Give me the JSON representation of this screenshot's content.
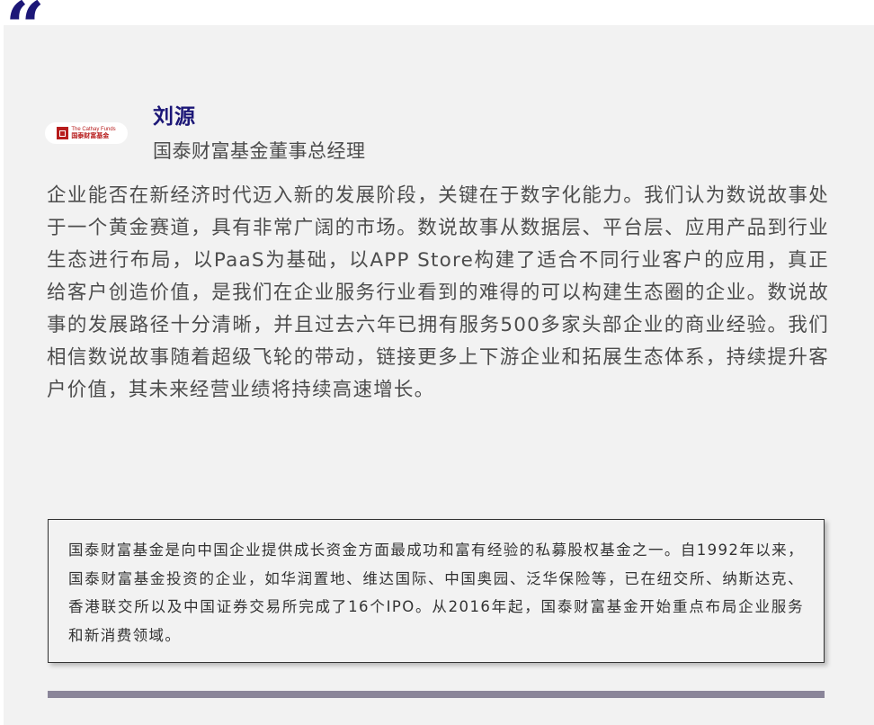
{
  "quote": {
    "mark": "“"
  },
  "logo": {
    "english": "The Cathay Funds",
    "chinese": "国泰财富基金"
  },
  "profile": {
    "name": "刘源",
    "title": "国泰财富基金董事总经理"
  },
  "quote_body": "企业能否在新经济时代迈入新的发展阶段，关键在于数字化能力。我们认为数说故事处于一个黄金赛道，具有非常广阔的市场。数说故事从数据层、平台层、应用产品到行业生态进行布局，以PaaS为基础，以APP Store构建了适合不同行业客户的应用，真正给客户创造价值，是我们在企业服务行业看到的难得的可以构建生态圈的企业。数说故事的发展路径十分清晰，并且过去六年已拥有服务500多家头部企业的商业经验。我们相信数说故事随着超级飞轮的带动，链接更多上下游企业和拓展生态体系，持续提升客户价值，其未来经营业绩将持续高速增长。",
  "about": "国泰财富基金是向中国企业提供成长资金方面最成功和富有经验的私募股权基金之一。自1992年以来，国泰财富基金投资的企业，如华润置地、维达国际、中国奥园、泛华保险等，已在纽交所、纳斯达克、香港联交所以及中国证券交易所完成了16个IPO。从2016年起，国泰财富基金开始重点布局企业服务和新消费领域。",
  "colors": {
    "accent": "#1c1777",
    "card_bg": "#f2f2f2",
    "text": "#4d4d4d",
    "bar": "#8a8599",
    "logo_red": "#b71c1c"
  }
}
